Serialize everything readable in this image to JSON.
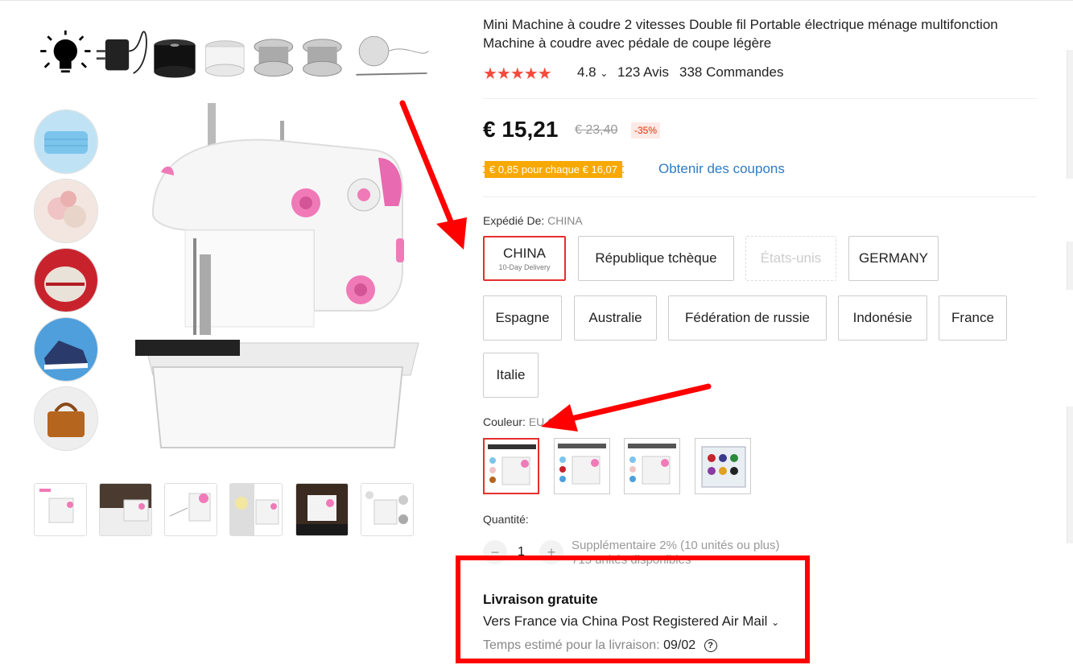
{
  "product": {
    "title": "Mini Machine à coudre 2 vitesses Double fil Portable électrique ménage multifonction Machine à coudre avec pédale de coupe légère",
    "stars": "★★★★★",
    "rating": "4.8",
    "rating_chevron": "⌄",
    "reviews": "123 Avis",
    "orders": "338 Commandes"
  },
  "price": {
    "current": "€ 15,21",
    "original": "€ 23,40",
    "discount": "-35%",
    "coupon": "€ 0,85 pour chaque € 16,07",
    "coupon_link": "Obtenir des coupons"
  },
  "ship_from": {
    "label": "Expédié De:",
    "selected_value": "CHINA",
    "options": [
      {
        "label": "CHINA",
        "sub": "10-Day Delivery",
        "state": "selected"
      },
      {
        "label": "République tchèque",
        "state": "normal"
      },
      {
        "label": "États-unis",
        "state": "disabled"
      },
      {
        "label": "GERMANY",
        "state": "normal"
      },
      {
        "label": "Espagne",
        "state": "normal"
      },
      {
        "label": "Australie",
        "state": "normal"
      },
      {
        "label": "Fédération de russie",
        "state": "normal"
      },
      {
        "label": "Indonésie",
        "state": "normal"
      },
      {
        "label": "France",
        "state": "normal"
      },
      {
        "label": "Italie",
        "state": "normal"
      }
    ]
  },
  "color": {
    "label": "Couleur:",
    "selected_value": "EU  G"
  },
  "quantity": {
    "label": "Quantité:",
    "value": "1",
    "minus": "−",
    "plus": "+",
    "bulk_note": "Supplémentaire 2% (10 unités ou plus)",
    "available": "715 unités disponibles"
  },
  "shipping": {
    "title": "Livraison gratuite",
    "via": "Vers France via China Post Registered Air Mail",
    "via_chevron": "⌄",
    "estimate_label": "Temps estimé pour la livraison:",
    "estimate_date": "09/02",
    "help": "?"
  },
  "annotation_color": "#ff0000",
  "accent": "#e62e2e"
}
